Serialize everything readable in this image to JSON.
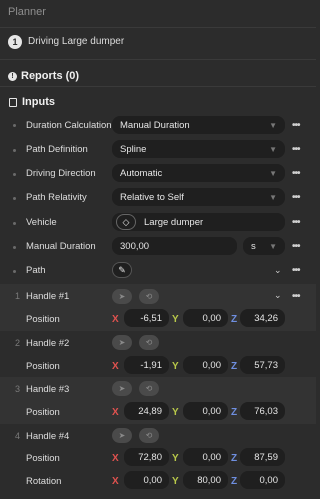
{
  "header": {
    "title": "Planner",
    "step_number": "1",
    "step_label": "Driving Large dumper"
  },
  "reports": {
    "title": "Reports (0)"
  },
  "inputs": {
    "title": "Inputs",
    "duration_calculation": {
      "label": "Duration Calculation",
      "value": "Manual Duration"
    },
    "path_definition": {
      "label": "Path Definition",
      "value": "Spline"
    },
    "driving_direction": {
      "label": "Driving Direction",
      "value": "Automatic"
    },
    "path_relativity": {
      "label": "Path Relativity",
      "value": "Relative to Self"
    },
    "vehicle": {
      "label": "Vehicle",
      "value": "Large dumper"
    },
    "manual_duration": {
      "label": "Manual Duration",
      "value": "300,00",
      "unit": "s"
    },
    "path": {
      "label": "Path"
    }
  },
  "handles": [
    {
      "index": "1",
      "label": "Handle #1",
      "position": {
        "label": "Position",
        "x": "-6,51",
        "y": "0,00",
        "z": "34,26"
      }
    },
    {
      "index": "2",
      "label": "Handle #2",
      "position": {
        "label": "Position",
        "x": "-1,91",
        "y": "0,00",
        "z": "57,73"
      }
    },
    {
      "index": "3",
      "label": "Handle #3",
      "position": {
        "label": "Position",
        "x": "24,89",
        "y": "0,00",
        "z": "76,03"
      }
    },
    {
      "index": "4",
      "label": "Handle #4",
      "position": {
        "label": "Position",
        "x": "72,80",
        "y": "0,00",
        "z": "87,59"
      },
      "rotation": {
        "label": "Rotation",
        "x": "0,00",
        "y": "80,00",
        "z": "0,00"
      }
    }
  ],
  "axes": {
    "x": "X",
    "y": "Y",
    "z": "Z"
  },
  "colors": {
    "x_axis": "#e0524f",
    "y_axis": "#b9c94a",
    "z_axis": "#6f8fe0",
    "background": "#2c2c2c",
    "field": "#1f1f1f"
  },
  "icons": {
    "reports": "exclamation-circle-icon",
    "inputs": "list-icon",
    "dropdown": "chevron-down-icon",
    "more": "more-dots-icon",
    "vehicle": "diamond-target-icon",
    "path": "pencil-icon",
    "handle_move": "arrow-cursor-icon",
    "handle_rotate": "rotate-icon"
  }
}
